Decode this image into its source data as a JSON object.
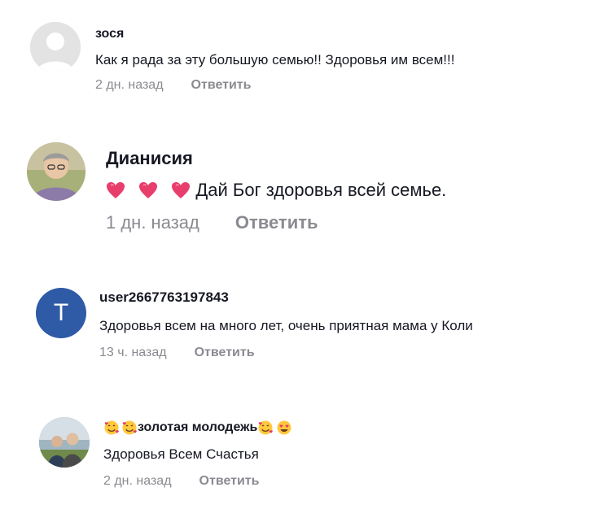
{
  "comments": [
    {
      "username": "зося",
      "text": "Как я рада за эту большую семью!! Здоровья им всем!!!",
      "time": "2 дн. назад",
      "reply_label": "Ответить",
      "avatar_icon": "default-user-avatar"
    },
    {
      "username": "Дианисия",
      "text": "Дай Бог здоровья всей семье.",
      "text_prefix_icons": [
        "heart-icon",
        "heart-icon",
        "heart-icon"
      ],
      "time": "1 дн. назад",
      "reply_label": "Ответить",
      "avatar_icon": "photo-avatar"
    },
    {
      "username": "user2667763197843",
      "text": "Здоровья всем на много лет, очень приятная мама у Коли",
      "time": "13 ч. назад",
      "reply_label": "Ответить",
      "avatar_letter": "T",
      "avatar_color": "#2f5aa5"
    },
    {
      "username": "золотая молодежь",
      "username_prefix_icons": [
        "smiling-face-with-hearts-icon",
        "smiling-face-with-hearts-icon"
      ],
      "username_suffix_icons": [
        "smiling-face-with-hearts-icon",
        "smiling-face-with-heart-eyes-icon"
      ],
      "text": "Здоровья Всем Счастья",
      "time": "2 дн. назад",
      "reply_label": "Ответить",
      "avatar_icon": "photo-avatar"
    }
  ],
  "colors": {
    "text_primary": "#161823",
    "text_secondary": "#8a8b91",
    "heart": "#e83e6c",
    "letter_avatar_bg": "#2f5aa5"
  }
}
